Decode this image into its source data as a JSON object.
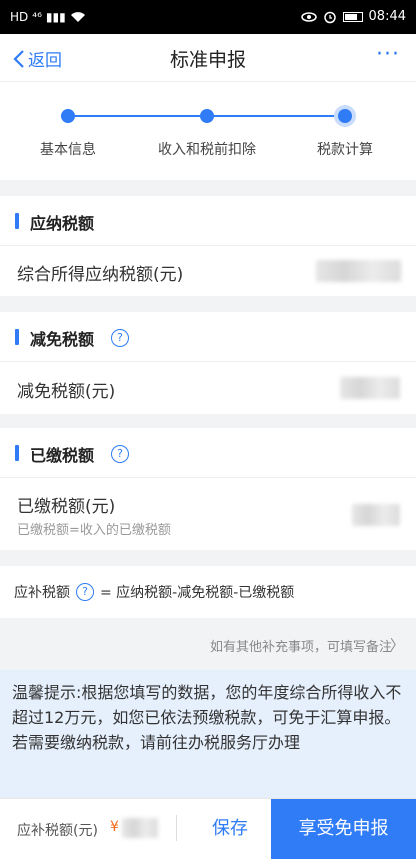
{
  "status_bar": {
    "time": "08:44",
    "left_icons": [
      "HD",
      "⁴⁶",
      "▮▮▮",
      "wifi"
    ]
  },
  "nav": {
    "back_label": "返回",
    "title": "标准申报",
    "more": "···"
  },
  "steps": [
    {
      "label": "基本信息"
    },
    {
      "label": "收入和税前扣除"
    },
    {
      "label": "税款计算"
    }
  ],
  "sections": {
    "payable": {
      "title": "应纳税额",
      "row_label": "综合所得应纳税额(元)"
    },
    "reduction": {
      "title": "减免税额",
      "help": "?",
      "row_label": "减免税额(元)"
    },
    "paid": {
      "title": "已缴税额",
      "help": "?",
      "row_label": "已缴税额(元)",
      "row_sub": "已缴税额=收入的已缴税额"
    }
  },
  "formula": {
    "label": "应补税额",
    "help": "?",
    "expression": "= 应纳税额-减免税额-已缴税额"
  },
  "remark": {
    "text": "如有其他补充事项，可填写备注",
    "chevron": "〉"
  },
  "tip": {
    "text": "温馨提示:根据您填写的数据，您的年度综合所得收入不超过12万元，如您已依法预缴税款，可免于汇算申报。若需要缴纳税款，请前往办税服务厅办理"
  },
  "bottom": {
    "amount_label": "应补税额(元)",
    "currency": "¥",
    "save_label": "保存",
    "primary_label": "享受免申报"
  },
  "colors": {
    "accent": "#2f7cf6",
    "tip_bg": "#e6f0fd",
    "currency": "#f26b1d"
  }
}
